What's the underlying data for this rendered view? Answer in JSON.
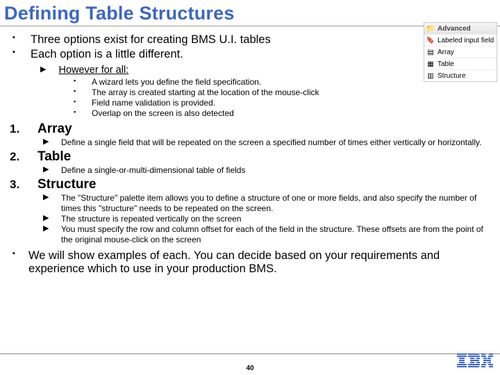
{
  "title": "Defining Table Structures",
  "intro": {
    "l1": "Three options exist for creating BMS U.I. tables",
    "l2": "Each option is a little different.",
    "however": "However for all:",
    "pts": {
      "a": "A wizard lets you define the field specification.",
      "b": "The array is created starting at the location of the mouse-click",
      "c": "Field name validation is provided.",
      "d": "Overlap on the screen is also detected"
    }
  },
  "opts": {
    "n1": "1.",
    "h1": "Array",
    "d1": "Define a single field that will be repeated on the screen a specified number of times either vertically or horizontally.",
    "n2": "2.",
    "h2": "Table",
    "d2": "Define a single-or-multi-dimensional table of fields",
    "n3": "3.",
    "h3": "Structure",
    "d3a": "The \"Structure\" palette item allows you to define a structure of one or more fields, and also specify the number of times this \"structure\" needs to be repeated on the screen.",
    "d3b": "The structure is repeated vertically on the screen",
    "d3c": "You must specify the row and column offset for each of the field in the structure. These offsets are from the point of the original mouse-click on the screen"
  },
  "closing": "We will show examples of each.  You can decide based on your requirements and experience which to use in your production BMS.",
  "page": "40",
  "palette": {
    "hdr": "Advanced",
    "i1": "Labeled input field",
    "i2": "Array",
    "i3": "Table",
    "i4": "Structure"
  }
}
